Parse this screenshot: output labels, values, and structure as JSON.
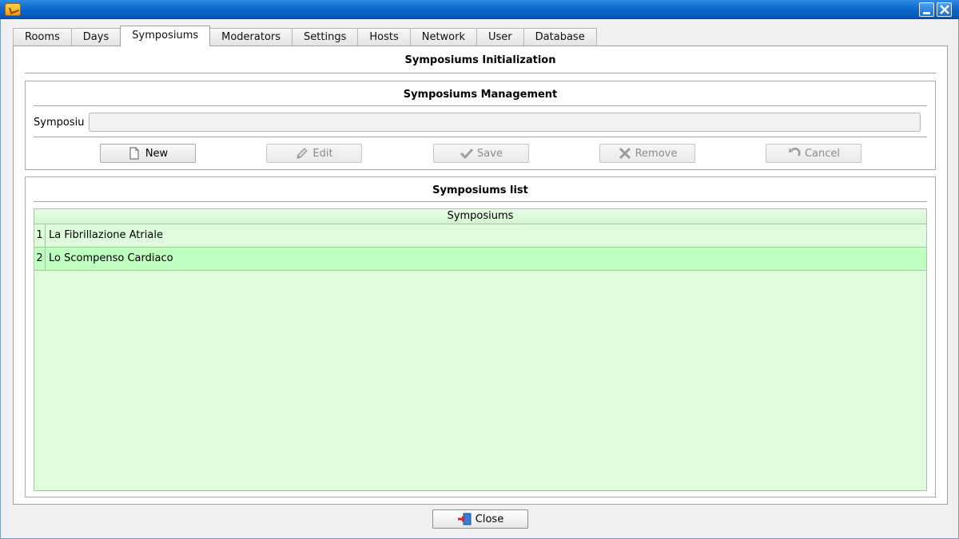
{
  "window": {
    "icon": "app-icon",
    "minimize_icon": "minimize-icon",
    "close_icon": "close-icon"
  },
  "tabs": [
    {
      "label": "Rooms",
      "active": false
    },
    {
      "label": "Days",
      "active": false
    },
    {
      "label": "Symposiums",
      "active": true
    },
    {
      "label": "Moderators",
      "active": false
    },
    {
      "label": "Settings",
      "active": false
    },
    {
      "label": "Hosts",
      "active": false
    },
    {
      "label": "Network",
      "active": false
    },
    {
      "label": "User",
      "active": false
    },
    {
      "label": "Database",
      "active": false
    }
  ],
  "panel": {
    "title": "Symposiums Initialization"
  },
  "management": {
    "title": "Symposiums Management",
    "field_label": "Symposiu",
    "field_value": "",
    "buttons": {
      "new": {
        "label": "New",
        "icon": "document-icon",
        "enabled": true
      },
      "edit": {
        "label": "Edit",
        "icon": "pencil-icon",
        "enabled": false
      },
      "save": {
        "label": "Save",
        "icon": "checkmark-icon",
        "enabled": false
      },
      "remove": {
        "label": "Remove",
        "icon": "x-icon",
        "enabled": false
      },
      "cancel": {
        "label": "Cancel",
        "icon": "undo-icon",
        "enabled": false
      }
    }
  },
  "list": {
    "title": "Symposiums list",
    "column_header": "Symposiums",
    "rows": [
      {
        "num": "1",
        "name": "La Fibrillazione Atriale",
        "selected": false
      },
      {
        "num": "2",
        "name": "Lo Scompenso Cardiaco",
        "selected": true
      }
    ]
  },
  "footer": {
    "close_label": "Close",
    "close_icon": "exit-door-icon"
  },
  "colors": {
    "titlebar": "#0a63c9",
    "list_background": "#dffddd",
    "selected_row": "#bfffbf"
  }
}
